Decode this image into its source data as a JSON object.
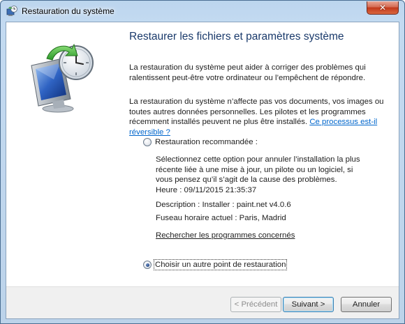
{
  "window": {
    "title": "Restauration du système",
    "close_glyph": "✕"
  },
  "content": {
    "heading": "Restaurer les fichiers et paramètres système",
    "intro": "La restauration du système peut aider à corriger des problèmes qui ralentissent peut-être votre ordinateur ou l’empêchent de répondre.",
    "note_text": "La restauration du système n’affecte pas vos documents, vos images ou toutes autres données personnelles. Les pilotes et les programmes récemment installés peuvent ne plus être installés. ",
    "note_link": "Ce processus est-il réversible ?",
    "option_recommended": {
      "label": "Restauration recommandée :",
      "checked": false,
      "description": "Sélectionnez cette option pour annuler l’installation la plus récente liée à une mise à jour, un pilote ou un logiciel, si vous pensez qu’il s’agit de la cause des problèmes.",
      "time": "Heure : 09/11/2015 21:35:37",
      "desc_line": "Description : Installer : paint.net v4.0.6",
      "timezone": "Fuseau horaire actuel : Paris, Madrid",
      "scan_link": "Rechercher les programmes concernés"
    },
    "option_other": {
      "label": "Choisir un autre point de restauration",
      "checked": true
    }
  },
  "buttons": {
    "back": "< Précédent",
    "next": "Suivant >",
    "cancel": "Annuler"
  },
  "icons": {
    "title": "system-restore-icon",
    "hero": "system-restore-monitor-clock-icon"
  },
  "colors": {
    "heading": "#1a3a6b",
    "link": "#0066cc",
    "titlebar": "#c3daf1",
    "close": "#c2381b"
  }
}
